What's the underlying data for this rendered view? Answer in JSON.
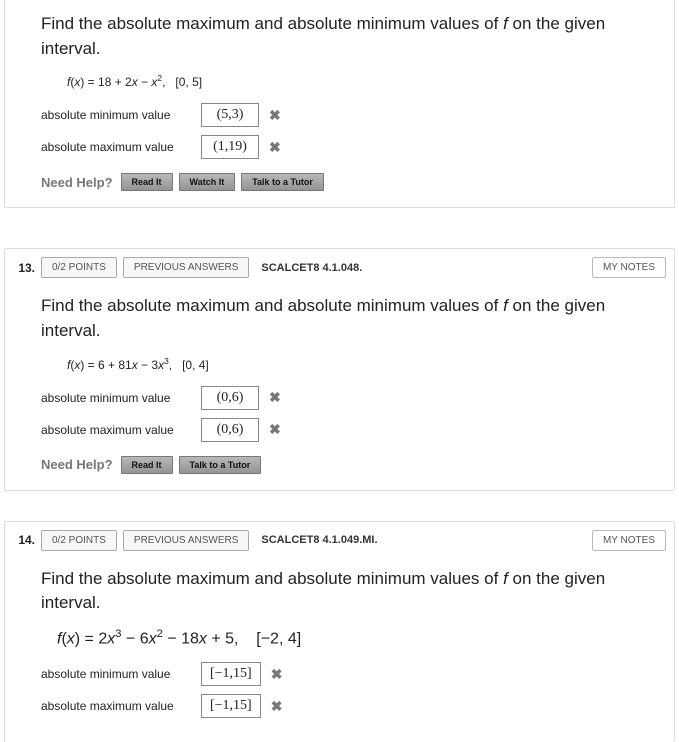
{
  "common": {
    "prompt_a": "Find the absolute maximum and absolute minimum values of ",
    "prompt_b": " on the given interval.",
    "fvar": "f",
    "min_label": "absolute minimum value",
    "max_label": "absolute maximum value",
    "need_help": "Need Help?",
    "prev_answers": "PREVIOUS ANSWERS",
    "my_notes": "MY NOTES",
    "read_it": "Read It",
    "watch_it": "Watch It",
    "talk_tutor": "Talk to a Tutor",
    "x_mark": "✖"
  },
  "q12": {
    "formula_html": "<i>f</i>(<i>x</i>) = 18 + 2<i>x</i> − <i>x</i><span class='sup'>2</span>, &nbsp;&nbsp;[0, 5]",
    "min_answer": "(5,3)",
    "max_answer": "(1,19)"
  },
  "q13": {
    "num": "13.",
    "points": "0/2 POINTS",
    "ref": "SCALCET8 4.1.048.",
    "formula_html": "<i>f</i>(<i>x</i>) = 6 + 81<i>x</i> − 3<i>x</i><span class='sup'>3</span>, &nbsp;&nbsp;[0, 4]",
    "min_answer": "(0,6)",
    "max_answer": "(0,6)"
  },
  "q14": {
    "num": "14.",
    "points": "0/2 POINTS",
    "ref": "SCALCET8 4.1.049.MI.",
    "formula_html": "<i>f</i>(<i>x</i>) = 2<i>x</i><span class='sup'>3</span> − 6<i>x</i><span class='sup'>2</span> − 18<i>x</i> + 5, &nbsp;&nbsp;&nbsp;[−2, 4]",
    "min_answer": "[−1,15]",
    "max_answer": "[−1,15]"
  }
}
